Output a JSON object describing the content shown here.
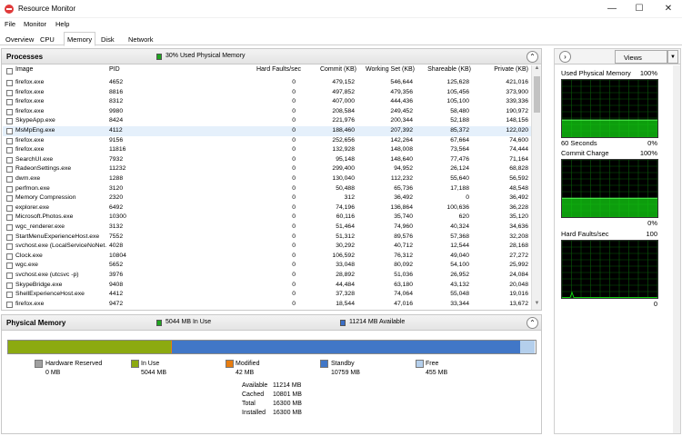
{
  "window": {
    "title": "Resource Monitor",
    "minimize_glyph": "—",
    "maximize_glyph": "☐",
    "close_glyph": "✕"
  },
  "menu": [
    "File",
    "Monitor",
    "Help"
  ],
  "tabs": [
    {
      "label": "Overview",
      "active": false
    },
    {
      "label": "CPU",
      "active": false
    },
    {
      "label": "Memory",
      "active": true
    },
    {
      "label": "Disk",
      "active": false
    },
    {
      "label": "Network",
      "active": false
    }
  ],
  "processes": {
    "title": "Processes",
    "indicator": "30% Used Physical Memory",
    "indicator_color": "#1fa51f",
    "collapse_glyph": "⌃",
    "columns": [
      "Image",
      "PID",
      "Hard Faults/sec",
      "Commit (KB)",
      "Working Set (KB)",
      "Shareable (KB)",
      "Private (KB)"
    ],
    "rows": [
      [
        "firefox.exe",
        "4652",
        "0",
        "479,152",
        "546,644",
        "125,628",
        "421,016"
      ],
      [
        "firefox.exe",
        "8816",
        "0",
        "497,852",
        "479,356",
        "105,456",
        "373,900"
      ],
      [
        "firefox.exe",
        "8312",
        "0",
        "407,000",
        "444,436",
        "105,100",
        "339,336"
      ],
      [
        "firefox.exe",
        "9980",
        "0",
        "208,584",
        "249,452",
        "58,480",
        "190,972"
      ],
      [
        "SkypeApp.exe",
        "8424",
        "0",
        "221,976",
        "200,344",
        "52,188",
        "148,156"
      ],
      [
        "MsMpEng.exe",
        "4112",
        "0",
        "188,460",
        "207,392",
        "85,372",
        "122,020"
      ],
      [
        "firefox.exe",
        "9156",
        "0",
        "252,656",
        "142,264",
        "67,664",
        "74,600"
      ],
      [
        "firefox.exe",
        "11816",
        "0",
        "132,928",
        "148,008",
        "73,564",
        "74,444"
      ],
      [
        "SearchUI.exe",
        "7932",
        "0",
        "95,148",
        "148,640",
        "77,476",
        "71,164"
      ],
      [
        "RadeonSettings.exe",
        "11232",
        "0",
        "299,400",
        "94,952",
        "26,124",
        "68,828"
      ],
      [
        "dwm.exe",
        "1288",
        "0",
        "130,040",
        "112,232",
        "55,640",
        "56,592"
      ],
      [
        "perfmon.exe",
        "3120",
        "0",
        "50,488",
        "65,736",
        "17,188",
        "48,548"
      ],
      [
        "Memory Compression",
        "2320",
        "0",
        "312",
        "36,492",
        "0",
        "36,492"
      ],
      [
        "explorer.exe",
        "6492",
        "0",
        "74,196",
        "136,864",
        "100,636",
        "36,228"
      ],
      [
        "Microsoft.Photos.exe",
        "10300",
        "0",
        "60,116",
        "35,740",
        "620",
        "35,120"
      ],
      [
        "wgc_renderer.exe",
        "3132",
        "0",
        "51,464",
        "74,960",
        "40,324",
        "34,636"
      ],
      [
        "StartMenuExperienceHost.exe",
        "7552",
        "0",
        "51,312",
        "89,576",
        "57,368",
        "32,208"
      ],
      [
        "svchost.exe (LocalServiceNoNet...",
        "4028",
        "0",
        "30,292",
        "40,712",
        "12,544",
        "28,168"
      ],
      [
        "Clock.exe",
        "10804",
        "0",
        "106,592",
        "76,312",
        "49,040",
        "27,272"
      ],
      [
        "wgc.exe",
        "5652",
        "0",
        "33,048",
        "80,092",
        "54,100",
        "25,992"
      ],
      [
        "svchost.exe (utcsvc -p)",
        "3976",
        "0",
        "28,892",
        "51,036",
        "26,952",
        "24,084"
      ],
      [
        "SkypeBridge.exe",
        "9408",
        "0",
        "44,484",
        "63,180",
        "43,132",
        "20,048"
      ],
      [
        "ShellExperienceHost.exe",
        "4412",
        "0",
        "37,328",
        "74,064",
        "55,048",
        "19,016"
      ],
      [
        "firefox.exe",
        "9472",
        "0",
        "18,544",
        "47,016",
        "33,344",
        "13,672"
      ]
    ],
    "selected_row": 5,
    "scroll_up_glyph": "▲",
    "scroll_down_glyph": "▼"
  },
  "physical_memory": {
    "title": "Physical Memory",
    "in_use_indicator": "5044 MB In Use",
    "in_use_color": "#1fa51f",
    "available_indicator": "11214 MB Available",
    "available_color": "#3b6fc7",
    "collapse_glyph": "⌃",
    "total_mb": 16300,
    "bar_segments": [
      {
        "name": "Hardware Reserved",
        "mb": 0,
        "color": "#a0a0a0"
      },
      {
        "name": "In Use",
        "mb": 5044,
        "color": "#8caa10"
      },
      {
        "name": "Modified",
        "mb": 42,
        "color": "#e87d10"
      },
      {
        "name": "Standby",
        "mb": 10759,
        "color": "#4177c7"
      },
      {
        "name": "Free",
        "mb": 455,
        "color": "#b4cfec"
      }
    ],
    "legend": [
      {
        "label": "Hardware Reserved",
        "value": "0 MB",
        "color": "#a0a0a0"
      },
      {
        "label": "In Use",
        "value": "5044 MB",
        "color": "#8caa10"
      },
      {
        "label": "Modified",
        "value": "42 MB",
        "color": "#e87d10"
      },
      {
        "label": "Standby",
        "value": "10759 MB",
        "color": "#4177c7"
      },
      {
        "label": "Free",
        "value": "455 MB",
        "color": "#b4cfec"
      }
    ],
    "summary": [
      {
        "label": "Available",
        "value": "11214 MB"
      },
      {
        "label": "Cached",
        "value": "10801 MB"
      },
      {
        "label": "Total",
        "value": "16300 MB"
      },
      {
        "label": "Installed",
        "value": "16300 MB"
      }
    ]
  },
  "graphs": {
    "expand_glyph": "›",
    "views_label": "Views",
    "views_drop_glyph": "▼",
    "items": [
      {
        "title": "Used Physical Memory",
        "max": "100%",
        "sub": "60 Seconds",
        "min": "0%",
        "fill_percent": 30,
        "color": "#11d111"
      },
      {
        "title": "Commit Charge",
        "max": "100%",
        "sub": "",
        "min": "0%",
        "fill_percent": 33,
        "color": "#11d111"
      },
      {
        "title": "Hard Faults/sec",
        "max": "100",
        "sub": "",
        "min": "0",
        "fill_percent": 0,
        "color": "#11d111"
      }
    ]
  }
}
